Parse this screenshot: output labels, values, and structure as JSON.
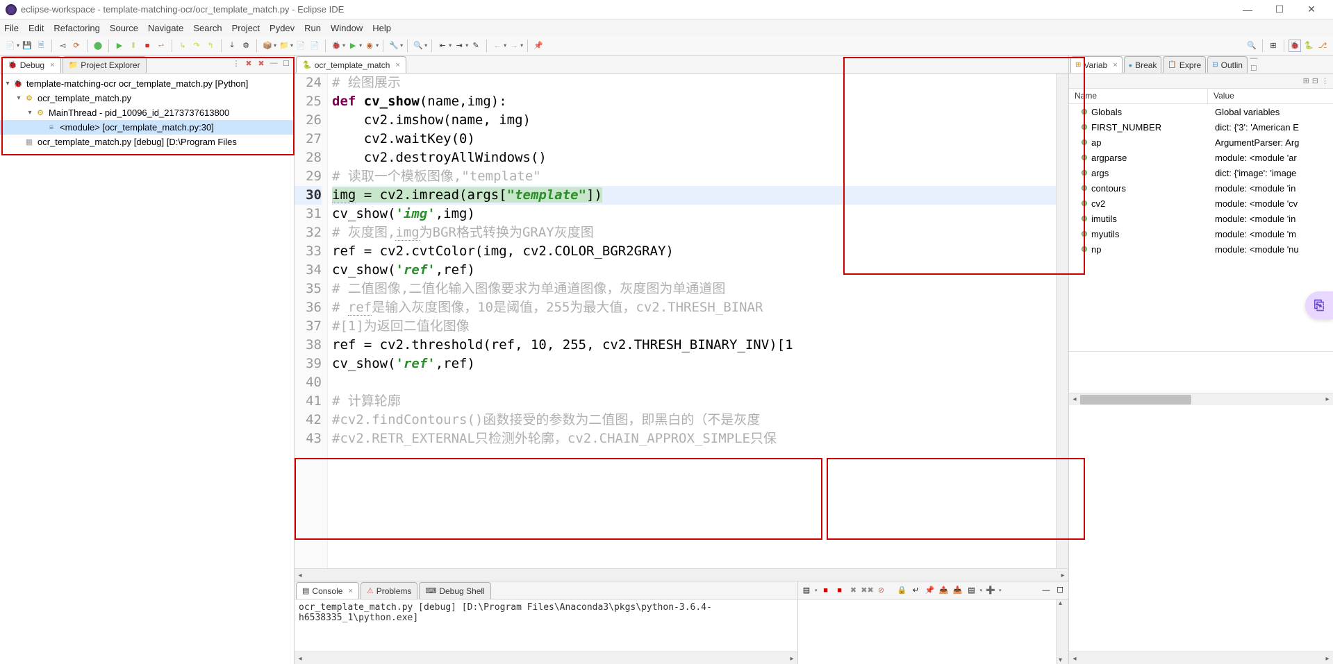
{
  "titlebar": {
    "text": "eclipse-workspace - template-matching-ocr/ocr_template_match.py - Eclipse IDE"
  },
  "menubar": [
    "File",
    "Edit",
    "Refactoring",
    "Source",
    "Navigate",
    "Search",
    "Project",
    "Pydev",
    "Run",
    "Window",
    "Help"
  ],
  "left": {
    "tabs": {
      "debug": "Debug",
      "explorer": "Project Explorer"
    },
    "tree": {
      "root": "template-matching-ocr ocr_template_match.py [Python]",
      "node1": "ocr_template_match.py",
      "node2": "MainThread - pid_10096_id_2173737613800",
      "node3": "<module> [ocr_template_match.py:30]",
      "node4": "ocr_template_match.py [debug] [D:\\Program Files"
    }
  },
  "editor": {
    "tab": "ocr_template_match",
    "lines": [
      {
        "n": 24,
        "html": "<span class='cmt'># 绘图展示</span>"
      },
      {
        "n": 25,
        "html": "<span class='kw'>def</span> <span class='fn'>cv_show</span>(name,img):",
        "bp": true
      },
      {
        "n": 26,
        "html": "    cv2.imshow(name, img)"
      },
      {
        "n": 27,
        "html": "    cv2.waitKey(<span class='num'>0</span>)"
      },
      {
        "n": 28,
        "html": "    cv2.destroyAllWindows()"
      },
      {
        "n": 29,
        "html": "<span class='cmt'># 读取一个模板图像,\"template\"</span>"
      },
      {
        "n": 30,
        "html": "<span class='hl'><span class='ident'>img</span> = cv2.imread(args[<span class='strg'>\"template\"</span>])</span>",
        "current": true,
        "bp": true
      },
      {
        "n": 31,
        "html": "cv_show(<span class='strg'>'img'</span>,img)"
      },
      {
        "n": 32,
        "html": "<span class='cmt'># 灰度图,<span class='ident'>img</span>为BGR格式转换为GRAY灰度图</span>"
      },
      {
        "n": 33,
        "html": "ref = cv2.cvtColor(img, cv2.COLOR_BGR2GRAY)"
      },
      {
        "n": 34,
        "html": "cv_show(<span class='strg'>'ref'</span>,ref)"
      },
      {
        "n": 35,
        "html": "<span class='cmt'># 二值图像,二值化输入图像要求为单通道图像，灰度图为单通道图</span>",
        "bp": true
      },
      {
        "n": 36,
        "html": "<span class='cmt'># <span class='ident'>ref</span>是输入灰度图像，10是阈值，255为最大值，cv2.THRESH_BINAR</span>"
      },
      {
        "n": 37,
        "html": "<span class='cmt'>#[1]为返回二值化图像</span>"
      },
      {
        "n": 38,
        "html": "ref = cv2.threshold(ref, <span class='num'>10</span>, <span class='num'>255</span>, cv2.THRESH_BINARY_INV)[1"
      },
      {
        "n": 39,
        "html": "cv_show(<span class='strg'>'ref'</span>,ref)"
      },
      {
        "n": 40,
        "html": ""
      },
      {
        "n": 41,
        "html": "<span class='cmt'># 计算轮廓</span>",
        "bp": true
      },
      {
        "n": 42,
        "html": "<span class='cmt'>#cv2.findContours()函数接受的参数为二值图，即黑白的（不是灰度</span>"
      },
      {
        "n": 43,
        "html": "<span class='cmt'>#cv2.RETR_EXTERNAL只检测外轮廓，cv2.CHAIN_APPROX_SIMPLE只保</span>"
      }
    ]
  },
  "vars": {
    "tabs": {
      "variab": "Variab",
      "break": "Break",
      "expre": "Expre",
      "outlin": "Outlin"
    },
    "cols": {
      "name": "Name",
      "value": "Value"
    },
    "rows": [
      {
        "name": "Globals",
        "value": "Global variables"
      },
      {
        "name": "FIRST_NUMBER",
        "value": "dict: {'3': 'American E"
      },
      {
        "name": "ap",
        "value": "ArgumentParser: Arg"
      },
      {
        "name": "argparse",
        "value": "module: <module 'ar"
      },
      {
        "name": "args",
        "value": "dict: {'image': 'image"
      },
      {
        "name": "contours",
        "value": "module: <module 'in"
      },
      {
        "name": "cv2",
        "value": "module: <module 'cv"
      },
      {
        "name": "imutils",
        "value": "module: <module 'in"
      },
      {
        "name": "myutils",
        "value": "module: <module 'm"
      },
      {
        "name": "np",
        "value": "module: <module 'nu"
      }
    ]
  },
  "console": {
    "tabs": {
      "console": "Console",
      "problems": "Problems",
      "debugshell": "Debug Shell"
    },
    "text": "ocr_template_match.py [debug] [D:\\Program Files\\Anaconda3\\pkgs\\python-3.6.4-h6538335_1\\python.exe]"
  }
}
